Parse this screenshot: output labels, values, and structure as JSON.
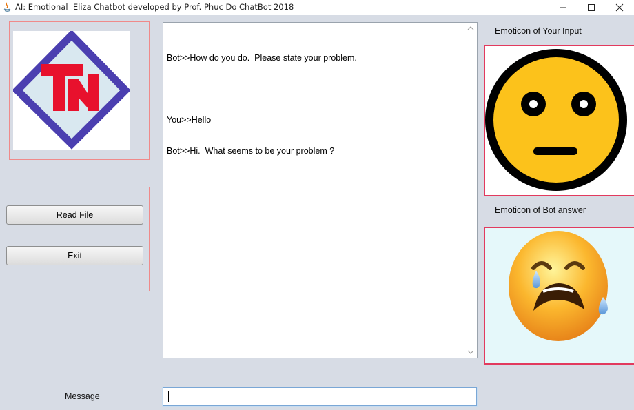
{
  "window": {
    "title": "AI: Emotional  Eliza Chatbot developed by Prof. Phuc Do ChatBot 2018",
    "icons": [
      "java-app-icon",
      "minimize-icon",
      "maximize-icon",
      "close-icon"
    ]
  },
  "logo": {
    "text": "TN",
    "colors": {
      "diamond": "#4b3fb0",
      "letters": "#e8112d",
      "fill": "#d9e8f0"
    }
  },
  "buttons": {
    "read_file": "Read File",
    "exit": "Exit"
  },
  "chat": {
    "lines": [
      "Bot>>How do you do.  Please state your problem.",
      "",
      "You>>Hello",
      "Bot>>Hi.  What seems to be your problem ?"
    ]
  },
  "emoticons": {
    "input_label": "Emoticon of Your Input",
    "input_icon": "neutral-face-icon",
    "bot_label": "Emoticon of Bot answer",
    "bot_icon": "crying-face-icon"
  },
  "message": {
    "label": "Message",
    "value": ""
  },
  "colors": {
    "background": "#d7dce5",
    "panel_border": "#f08a8a",
    "strong_border": "#e23a5e"
  }
}
